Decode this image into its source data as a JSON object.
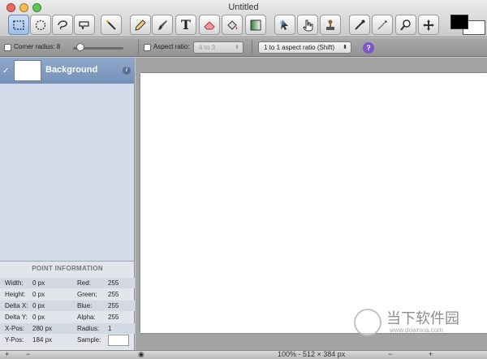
{
  "window": {
    "title": "Untitled"
  },
  "toolbar": {
    "tools": [
      {
        "name": "rect-select-icon"
      },
      {
        "name": "ellipse-select-icon"
      },
      {
        "name": "lasso-icon"
      },
      {
        "name": "polygon-lasso-icon"
      },
      {
        "name": "magic-wand-icon"
      },
      {
        "name": "pencil-icon"
      },
      {
        "name": "brush-icon"
      },
      {
        "name": "text-icon",
        "label": "T"
      },
      {
        "name": "eraser-icon"
      },
      {
        "name": "paint-bucket-icon"
      },
      {
        "name": "gradient-icon"
      },
      {
        "name": "move-icon"
      },
      {
        "name": "hand-pointer-icon"
      },
      {
        "name": "clone-stamp-icon"
      },
      {
        "name": "eyedropper-icon"
      },
      {
        "name": "smudge-icon"
      },
      {
        "name": "zoom-icon"
      },
      {
        "name": "pan-icon"
      }
    ],
    "primary_color": "#000000",
    "secondary_color": "#ffffff"
  },
  "options": {
    "corner_radius_label": "Corner radius: 8",
    "aspect_ratio_label": "Aspect ratio:",
    "aspect_ratio_value": "4 to 3",
    "aspect_mode_value": "1 to 1 aspect ratio (Shift)",
    "help_label": "?"
  },
  "layers": [
    {
      "name": "Background",
      "visible": true
    }
  ],
  "point_info": {
    "header": "POINT INFORMATION",
    "rows": [
      {
        "l1": "Width:",
        "v1": "0 px",
        "l2": "Red:",
        "v2": "255"
      },
      {
        "l1": "Height:",
        "v1": "0 px",
        "l2": "Green:",
        "v2": "255"
      },
      {
        "l1": "Delta X:",
        "v1": "0 px",
        "l2": "Blue:",
        "v2": "255"
      },
      {
        "l1": "Delta Y:",
        "v1": "0 px",
        "l2": "Alpha:",
        "v2": "255"
      },
      {
        "l1": "X-Pos:",
        "v1": "280 px",
        "l2": "Radius:",
        "v2": "1"
      },
      {
        "l1": "Y-Pos:",
        "v1": "184 px",
        "l2": "Sample:",
        "v2": ""
      }
    ]
  },
  "status": {
    "zoom": "100% - 512 × 384 px"
  },
  "watermark": {
    "brand": "当下软件园",
    "url": "www.downxia.com"
  }
}
